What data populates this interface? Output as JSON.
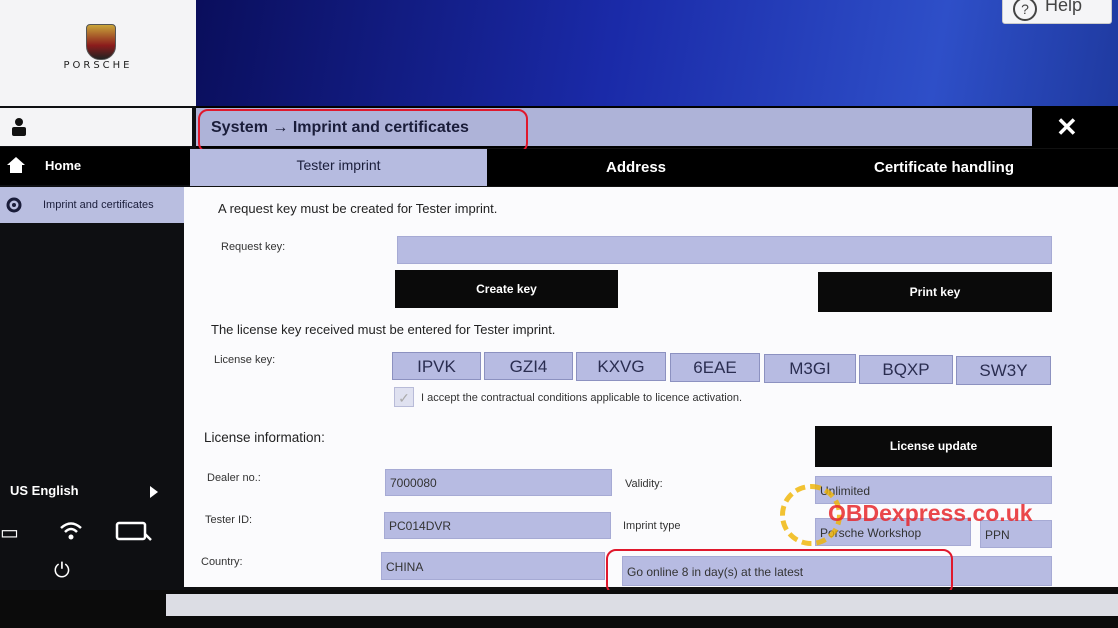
{
  "brand": {
    "name": "PORSCHE"
  },
  "help": {
    "label": "Help"
  },
  "sidebar": {
    "items": [
      {
        "label": "Home"
      },
      {
        "label": "Imprint and certificates"
      }
    ],
    "language": "US English"
  },
  "title": "System → Imprint and certificates",
  "tabs": [
    {
      "label": "Tester imprint",
      "active": true
    },
    {
      "label": "Address",
      "active": false
    },
    {
      "label": "Certificate handling",
      "active": false
    }
  ],
  "request": {
    "instruction": "A request key must be created for Tester imprint.",
    "label": "Request key:",
    "value": "",
    "create_button": "Create key",
    "print_button": "Print key"
  },
  "license": {
    "instruction": "The license key received must be entered for Tester imprint.",
    "label": "License key:",
    "segments": [
      "IPVK",
      "GZI4",
      "KXVG",
      "6EAE",
      "M3GI",
      "BQXP",
      "SW3Y"
    ],
    "accept_text": "I accept the contractual conditions applicable to licence activation."
  },
  "info": {
    "heading": "License information:",
    "update_button": "License update",
    "dealer_label": "Dealer no.:",
    "dealer_value": "7000080",
    "tester_label": "Tester ID:",
    "tester_value": "PC014DVR",
    "country_label": "Country:",
    "country_value": "CHINA",
    "validity_label": "Validity:",
    "validity_value": "Unlimited",
    "imprint_label": "Imprint type",
    "imprint_value": "Porsche Workshop",
    "imprint_code": "PPN",
    "online_value": "Go online 8 in day(s) at the latest"
  },
  "watermark": "OBDexpress.co.uk",
  "colors": {
    "accent": "#b7bbe2",
    "annotation": "#e0182c"
  }
}
